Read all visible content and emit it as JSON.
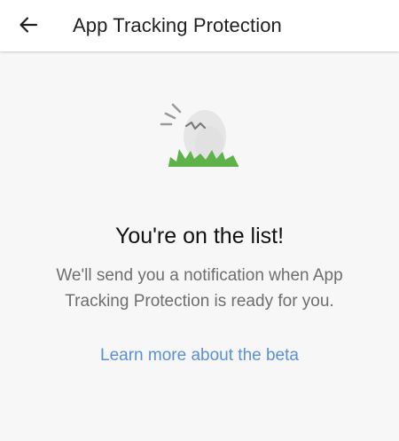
{
  "app_bar": {
    "title": "App Tracking Protection",
    "back_icon": "arrow-left-icon"
  },
  "main": {
    "illustration_icon": "hatching-egg-icon",
    "headline": "You're on the list!",
    "message": "We'll send you a notification when App Tracking Protection is ready for you.",
    "learn_more_link": "Learn more about the beta"
  },
  "colors": {
    "app_bar_background": "#ffffff",
    "page_background": "#f7f7f7",
    "title_text": "#1f1f1f",
    "body_text": "#6e6e6e",
    "link": "#5b8fd6",
    "grass": "#5fb24a",
    "egg": "#e6e6e6"
  }
}
